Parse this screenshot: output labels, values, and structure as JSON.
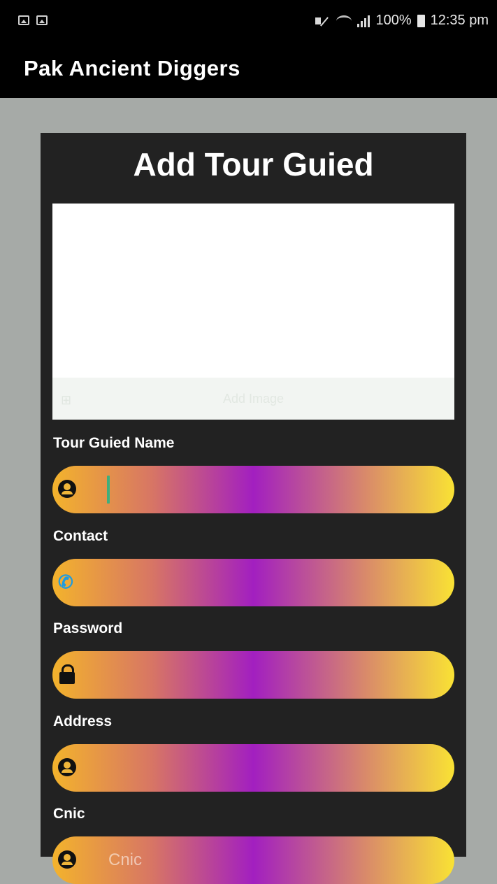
{
  "status_bar": {
    "battery": "100%",
    "time": "12:35 pm",
    "left_icons": [
      "gallery-icon",
      "screenshot-icon"
    ],
    "right_icons": [
      "mute-icon",
      "wifi-icon",
      "signal-icon",
      "battery-icon"
    ]
  },
  "app_bar": {
    "title": "Pak Ancient Diggers"
  },
  "form": {
    "title": "Add Tour Guied",
    "image_picker": {
      "label": "Add Image",
      "icon": "add-image-icon"
    },
    "fields": {
      "name": {
        "label": "Tour Guied Name",
        "icon": "person-icon",
        "value": ""
      },
      "contact": {
        "label": "Contact",
        "icon": "phone-add-icon",
        "value": ""
      },
      "password": {
        "label": "Password",
        "icon": "lock-icon",
        "value": ""
      },
      "address": {
        "label": "Address",
        "icon": "person-pin-icon",
        "value": ""
      },
      "cnic": {
        "label": "Cnic",
        "icon": "person-icon",
        "placeholder": "Cnic"
      }
    }
  },
  "colors": {
    "card_bg": "#222222",
    "page_bg": "#a6aaa7",
    "gradient_start": "#f3b32c",
    "gradient_mid": "#a21fc0",
    "gradient_end": "#f9e234"
  }
}
